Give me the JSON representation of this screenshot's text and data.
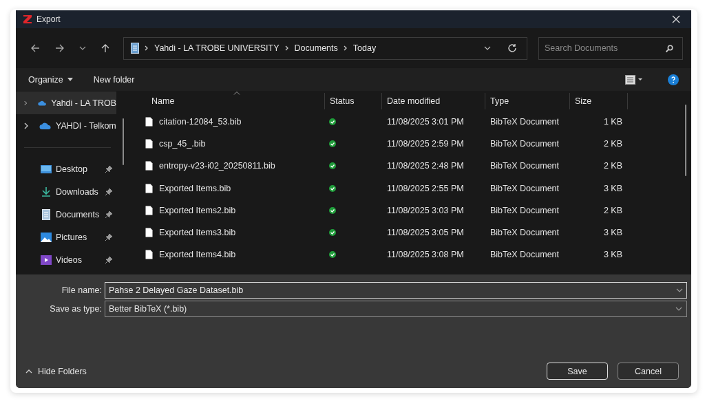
{
  "window": {
    "title": "Export"
  },
  "nav": {
    "breadcrumb": [
      "Yahdi - LA TROBE UNIVERSITY",
      "Documents",
      "Today"
    ],
    "search": {
      "placeholder": "Search Documents"
    }
  },
  "toolbar": {
    "organize": "Organize",
    "new_folder": "New folder"
  },
  "sidebar": {
    "items": [
      {
        "kind": "tree",
        "label": "Yahdi - LA TROB",
        "selected": true
      },
      {
        "kind": "tree",
        "label": "YAHDI - Telkom",
        "selected": false
      },
      {
        "kind": "quick",
        "label": "Desktop",
        "selected": false
      },
      {
        "kind": "quick",
        "label": "Downloads",
        "selected": false
      },
      {
        "kind": "quick",
        "label": "Documents",
        "selected": false
      },
      {
        "kind": "quick",
        "label": "Pictures",
        "selected": false
      },
      {
        "kind": "quick",
        "label": "Videos",
        "selected": false
      }
    ]
  },
  "table": {
    "columns": [
      "Name",
      "Status",
      "Date modified",
      "Type",
      "Size"
    ],
    "rows": [
      {
        "name": "citation-12084_53.bib",
        "synced": true,
        "date": "11/08/2025 3:01 PM",
        "type": "BibTeX Document",
        "size": "1 KB"
      },
      {
        "name": "csp_45_.bib",
        "synced": true,
        "date": "11/08/2025 2:59 PM",
        "type": "BibTeX Document",
        "size": "2 KB"
      },
      {
        "name": "entropy-v23-i02_20250811.bib",
        "synced": true,
        "date": "11/08/2025 2:48 PM",
        "type": "BibTeX Document",
        "size": "2 KB"
      },
      {
        "name": "Exported Items.bib",
        "synced": true,
        "date": "11/08/2025 2:55 PM",
        "type": "BibTeX Document",
        "size": "3 KB"
      },
      {
        "name": "Exported Items2.bib",
        "synced": true,
        "date": "11/08/2025 3:03 PM",
        "type": "BibTeX Document",
        "size": "2 KB"
      },
      {
        "name": "Exported Items3.bib",
        "synced": true,
        "date": "11/08/2025 3:05 PM",
        "type": "BibTeX Document",
        "size": "3 KB"
      },
      {
        "name": "Exported Items4.bib",
        "synced": true,
        "date": "11/08/2025 3:08 PM",
        "type": "BibTeX Document",
        "size": "3 KB"
      }
    ]
  },
  "form": {
    "file_name_label": "File name:",
    "file_name": "Pahse 2 Delayed Gaze Dataset.bib",
    "type_label": "Save as type:",
    "type_value": "Better BibTeX (*.bib)"
  },
  "footer": {
    "hide_folders": "Hide Folders",
    "buttons": [
      "Save",
      "Cancel"
    ]
  }
}
